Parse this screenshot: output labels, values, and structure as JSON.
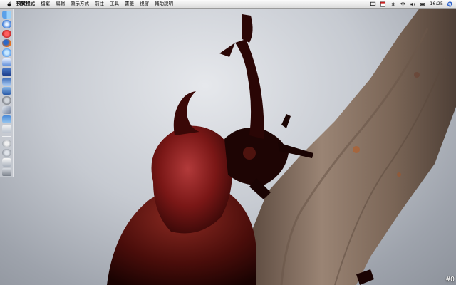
{
  "menubar": {
    "app_name": "預覽程式",
    "items": [
      "檔案",
      "編輯",
      "顯示方式",
      "前往",
      "工具",
      "書籤",
      "視窗",
      "輔助說明"
    ],
    "clock": "16:25"
  },
  "dock": {
    "items": [
      "finder-icon",
      "safari-icon",
      "itunes-icon",
      "firefox-icon",
      "ichat-icon",
      "mail-icon",
      "address-book-icon",
      "preview-icon",
      "app-store-icon",
      "system-preferences-icon",
      "xcode-icon",
      "photo-icon",
      "calendar-icon"
    ],
    "utilities": [
      "globe-icon",
      "search-icon",
      "dashboard-icon",
      "trash-icon"
    ]
  },
  "overlay": {
    "counter": "#0"
  },
  "colors": {
    "beetle": "#6a1412",
    "branch": "#8a7464",
    "menubar": "#ececec"
  }
}
